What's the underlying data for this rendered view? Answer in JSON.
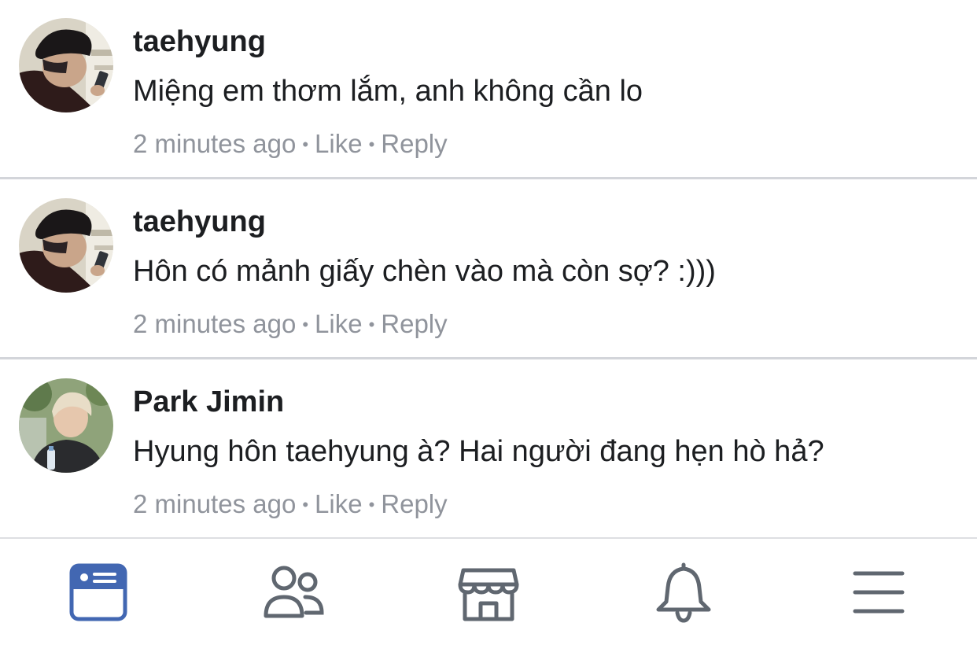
{
  "comments": [
    {
      "author": "taehyung",
      "text": "Miệng em thơm lắm, anh không cần lo",
      "time": "2 minutes ago",
      "like": "Like",
      "reply": "Reply",
      "avatar_icon": "dark-beret-avatar"
    },
    {
      "author": "taehyung",
      "text": "Hôn có mảnh giấy chèn vào mà còn sợ? :)))",
      "time": "2 minutes ago",
      "like": "Like",
      "reply": "Reply",
      "avatar_icon": "dark-beret-avatar"
    },
    {
      "author": "Park Jimin",
      "text": "Hyung hôn taehyung à? Hai người đang hẹn hò hả?",
      "time": "2 minutes ago",
      "like": "Like",
      "reply": "Reply",
      "avatar_icon": "light-hair-avatar"
    }
  ],
  "separator": "•",
  "tabbar": {
    "tabs": [
      {
        "icon": "news-feed-icon",
        "active": true
      },
      {
        "icon": "friends-icon",
        "active": false
      },
      {
        "icon": "marketplace-icon",
        "active": false
      },
      {
        "icon": "notifications-bell-icon",
        "active": false
      },
      {
        "icon": "menu-icon",
        "active": false
      }
    ]
  },
  "colors": {
    "text": "#1c1e21",
    "meta": "#90949c",
    "divider": "#d3d5da",
    "active_tab": "#4267b2",
    "inactive_tab": "#606770"
  }
}
